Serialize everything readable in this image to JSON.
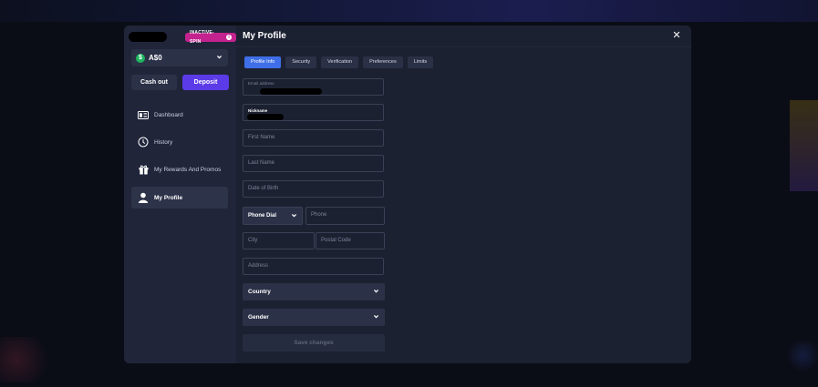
{
  "sidebar": {
    "badge_label": "INACTIVE-SPIN",
    "balance": "A$0",
    "cashout_label": "Cash out",
    "deposit_label": "Deposit",
    "items": [
      {
        "label": "Dashboard",
        "icon": "dashboard-icon"
      },
      {
        "label": "History",
        "icon": "history-icon"
      },
      {
        "label": "My Rewards And Promos",
        "icon": "gift-icon"
      },
      {
        "label": "My Profile",
        "icon": "user-icon",
        "active": true
      }
    ]
  },
  "header": {
    "title": "My Profile",
    "close_symbol": "✕"
  },
  "tabs": [
    "Profile Info",
    "Security",
    "Verification",
    "Preferences",
    "Limits"
  ],
  "form": {
    "email_label": "Email address",
    "nickname_label": "Nickname",
    "first_name_placeholder": "First Name",
    "last_name_placeholder": "Last Name",
    "dob_placeholder": "Date of Birth",
    "phone_dial_label": "Phone Dial",
    "phone_placeholder": "Phone",
    "city_placeholder": "City",
    "postal_placeholder": "Postal Code",
    "address_placeholder": "Address",
    "country_label": "Country",
    "gender_label": "Gender",
    "save_label": "Save changes"
  },
  "colors": {
    "accent": "#3f6fe8",
    "deposit": "#5b3be8",
    "badge": "#c4238f",
    "balance_icon": "#1eb35e"
  }
}
